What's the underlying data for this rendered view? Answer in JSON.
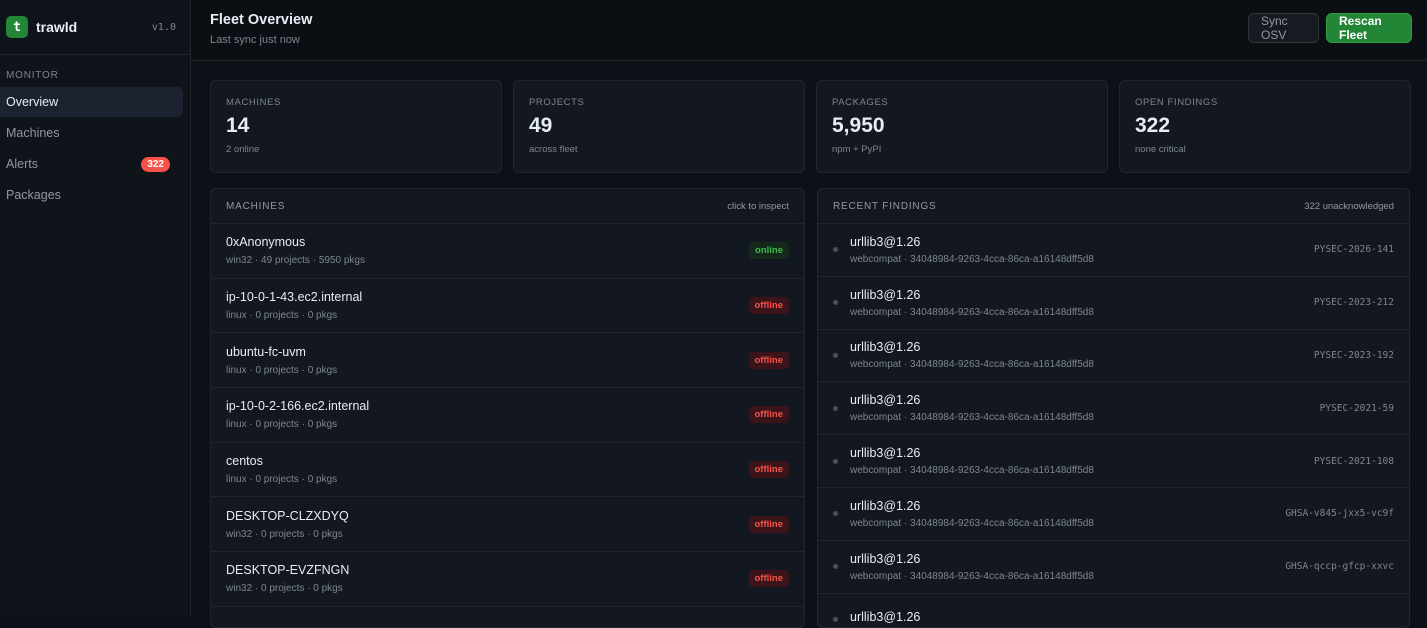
{
  "app": {
    "logo_letter": "t",
    "name": "trawld",
    "version": "v1.0"
  },
  "sidebar": {
    "section_label": "MONITOR",
    "items": [
      {
        "label": "Overview",
        "active": true
      },
      {
        "label": "Machines"
      },
      {
        "label": "Alerts",
        "badge": "322"
      },
      {
        "label": "Packages"
      }
    ]
  },
  "header": {
    "title": "Fleet Overview",
    "subtitle": "Last sync just now",
    "sync_label": "Sync OSV",
    "rescan_label": "Rescan Fleet"
  },
  "stats": [
    {
      "label": "MACHINES",
      "value": "14",
      "sub": "2 online"
    },
    {
      "label": "PROJECTS",
      "value": "49",
      "sub": "across fleet"
    },
    {
      "label": "PACKAGES",
      "value": "5,950",
      "sub": "npm + PyPI"
    },
    {
      "label": "OPEN FINDINGS",
      "value": "322",
      "sub": "none critical"
    }
  ],
  "machines_panel": {
    "title": "MACHINES",
    "hint": "click to inspect",
    "rows": [
      {
        "name": "0xAnonymous",
        "meta": "win32 · 49 projects · 5950 pkgs",
        "status": "online"
      },
      {
        "name": "ip-10-0-1-43.ec2.internal",
        "meta": "linux · 0 projects · 0 pkgs",
        "status": "offline"
      },
      {
        "name": "ubuntu-fc-uvm",
        "meta": "linux · 0 projects · 0 pkgs",
        "status": "offline"
      },
      {
        "name": "ip-10-0-2-166.ec2.internal",
        "meta": "linux · 0 projects · 0 pkgs",
        "status": "offline"
      },
      {
        "name": "centos",
        "meta": "linux · 0 projects · 0 pkgs",
        "status": "offline"
      },
      {
        "name": "DESKTOP-CLZXDYQ",
        "meta": "win32 · 0 projects · 0 pkgs",
        "status": "offline"
      },
      {
        "name": "DESKTOP-EVZFNGN",
        "meta": "win32 · 0 projects · 0 pkgs",
        "status": "offline"
      }
    ]
  },
  "findings_panel": {
    "title": "RECENT FINDINGS",
    "hint": "322 unacknowledged",
    "rows": [
      {
        "pkg": "urllib3@1.26",
        "meta": "webcompat · 34048984-9263-4cca-86ca-a16148dff5d8",
        "id": "PYSEC-2026-141"
      },
      {
        "pkg": "urllib3@1.26",
        "meta": "webcompat · 34048984-9263-4cca-86ca-a16148dff5d8",
        "id": "PYSEC-2023-212"
      },
      {
        "pkg": "urllib3@1.26",
        "meta": "webcompat · 34048984-9263-4cca-86ca-a16148dff5d8",
        "id": "PYSEC-2023-192"
      },
      {
        "pkg": "urllib3@1.26",
        "meta": "webcompat · 34048984-9263-4cca-86ca-a16148dff5d8",
        "id": "PYSEC-2021-59"
      },
      {
        "pkg": "urllib3@1.26",
        "meta": "webcompat · 34048984-9263-4cca-86ca-a16148dff5d8",
        "id": "PYSEC-2021-108"
      },
      {
        "pkg": "urllib3@1.26",
        "meta": "webcompat · 34048984-9263-4cca-86ca-a16148dff5d8",
        "id": "GHSA-v845-jxx5-vc9f"
      },
      {
        "pkg": "urllib3@1.26",
        "meta": "webcompat · 34048984-9263-4cca-86ca-a16148dff5d8",
        "id": "GHSA-qccp-gfcp-xxvc"
      },
      {
        "pkg": "urllib3@1.26",
        "meta": "",
        "id": ""
      }
    ]
  }
}
